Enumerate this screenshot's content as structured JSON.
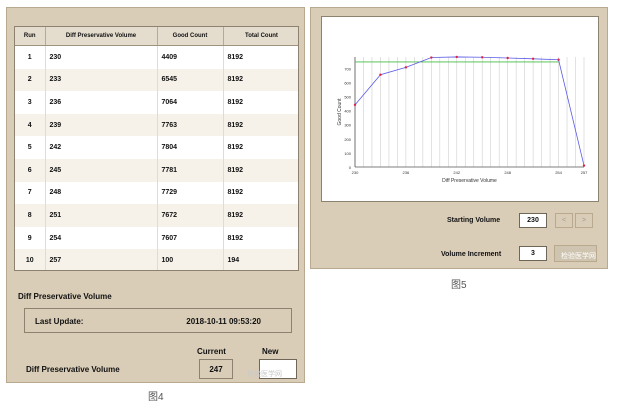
{
  "left_panel": {
    "table": {
      "headers": [
        "Run",
        "Diff Preservative Volume",
        "Good Count",
        "Total Count"
      ],
      "rows": [
        [
          "1",
          "230",
          "4409",
          "8192"
        ],
        [
          "2",
          "233",
          "6545",
          "8192"
        ],
        [
          "3",
          "236",
          "7064",
          "8192"
        ],
        [
          "4",
          "239",
          "7763",
          "8192"
        ],
        [
          "5",
          "242",
          "7804",
          "8192"
        ],
        [
          "6",
          "245",
          "7781",
          "8192"
        ],
        [
          "7",
          "248",
          "7729",
          "8192"
        ],
        [
          "8",
          "251",
          "7672",
          "8192"
        ],
        [
          "9",
          "254",
          "7607",
          "8192"
        ],
        [
          "10",
          "257",
          "100",
          "194"
        ]
      ]
    },
    "section_title": "Diff Preservative Volume",
    "last_update_label": "Last Update:",
    "last_update_value": "2018-10-11 09:53:20",
    "current_header": "Current",
    "new_header": "New",
    "param_label": "Diff Preservative Volume",
    "current_value": "247",
    "new_value": "",
    "watermark": "检验医学网",
    "caption": "图4"
  },
  "right_panel": {
    "starting_volume_label": "Starting Volume",
    "starting_volume_value": "230",
    "dec_icon": "<",
    "inc_icon": ">",
    "volume_increment_label": "Volume Increment",
    "volume_increment_value": "3",
    "watermark": "检验医学网",
    "caption": "图5",
    "colors": {
      "series_line": "#5a5ae6",
      "series_point": "#e0204a",
      "reference_line": "#44bb44",
      "grid": "#cfcfcf"
    }
  },
  "chart_data": {
    "type": "line",
    "xlabel": "Diff Preservative Volume",
    "ylabel": "Good Count",
    "xlim": [
      230,
      257
    ],
    "ylim": [
      0,
      7800
    ],
    "x_ticks": [
      "230",
      "233",
      "236",
      "239",
      "242",
      "245",
      "248",
      "251",
      "254",
      "257"
    ],
    "y_ticks": [
      "0",
      "100",
      "200",
      "300",
      "400",
      "500",
      "600",
      "700"
    ],
    "grid": true,
    "x": [
      230,
      233,
      236,
      239,
      242,
      245,
      248,
      251,
      254,
      257
    ],
    "y": [
      4409,
      6545,
      7064,
      7763,
      7804,
      7781,
      7729,
      7672,
      7607,
      100
    ],
    "reference_y": 7450
  }
}
